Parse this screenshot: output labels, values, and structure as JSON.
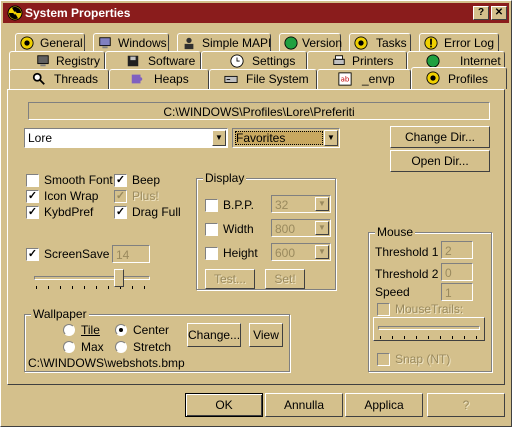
{
  "window": {
    "title": "System Properties",
    "help_btn": "?",
    "close_btn": "✕"
  },
  "tabs": {
    "row1": [
      {
        "label": "General",
        "icon": "radiation-icon"
      },
      {
        "label": "Windows",
        "icon": "computer-icon"
      },
      {
        "label": "Simple MAPI",
        "icon": "user-icon"
      },
      {
        "label": "Version",
        "icon": "globe-icon"
      },
      {
        "label": "Tasks",
        "icon": "radiation-icon"
      },
      {
        "label": "Error Log",
        "icon": "warning-icon"
      }
    ],
    "row2": [
      {
        "label": "Registry",
        "icon": "computer-icon"
      },
      {
        "label": "Software",
        "icon": "disk-icon"
      },
      {
        "label": "Settings",
        "icon": "clock-icon"
      },
      {
        "label": "Printers",
        "icon": "printer-icon"
      },
      {
        "label": "Internet",
        "icon": "globe-icon"
      }
    ],
    "row3": [
      {
        "label": "Threads",
        "icon": "magnifier-icon"
      },
      {
        "label": "Heaps",
        "icon": "puzzle-icon"
      },
      {
        "label": "File System",
        "icon": "drive-icon"
      },
      {
        "label": "_envp",
        "icon": "ab-icon"
      },
      {
        "label": "Profiles",
        "icon": "radiation-icon"
      }
    ],
    "active": "Profiles"
  },
  "profiles": {
    "path": "C:\\WINDOWS\\Profiles\\Lore\\Preferiti",
    "user_select": "Lore",
    "folder_select": "Favorites",
    "change_dir": "Change Dir...",
    "open_dir": "Open Dir...",
    "options": {
      "smooth_font": {
        "label": "Smooth Font",
        "checked": false
      },
      "icon_wrap": {
        "label": "Icon Wrap",
        "checked": true
      },
      "kybd_pref": {
        "label": "KybdPref",
        "checked": true
      },
      "beep": {
        "label": "Beep",
        "checked": true
      },
      "plus": {
        "label": "Plus!",
        "checked": true
      },
      "drag_full": {
        "label": "Drag Full",
        "checked": true
      },
      "screen_save": {
        "label": "ScreenSave",
        "checked": true
      },
      "screen_save_value": "14"
    },
    "display": {
      "title": "Display",
      "bpp": {
        "label": "B.P.P.",
        "value": "32"
      },
      "width": {
        "label": "Width",
        "value": "800"
      },
      "height": {
        "label": "Height",
        "value": "600"
      },
      "test": "Test...",
      "set": "Set!"
    },
    "mouse": {
      "title": "Mouse",
      "threshold1": {
        "label": "Threshold 1",
        "value": "2"
      },
      "threshold2": {
        "label": "Threshold 2",
        "value": "0"
      },
      "speed": {
        "label": "Speed",
        "value": "1"
      },
      "mouse_trails": "MouseTrails:",
      "snap": "Snap (NT)"
    },
    "wallpaper": {
      "title": "Wallpaper",
      "tile": "Tile",
      "center": "Center",
      "max": "Max",
      "stretch": "Stretch",
      "selected": "Center",
      "change": "Change...",
      "view": "View",
      "file": "C:\\WINDOWS\\webshots.bmp"
    }
  },
  "footer": {
    "ok": "OK",
    "cancel": "Annulla",
    "apply": "Applica",
    "help": "?"
  },
  "colors": {
    "face": "#d4c08c",
    "title_bar": "#8a1c1c",
    "highlight": "#c8a860"
  }
}
